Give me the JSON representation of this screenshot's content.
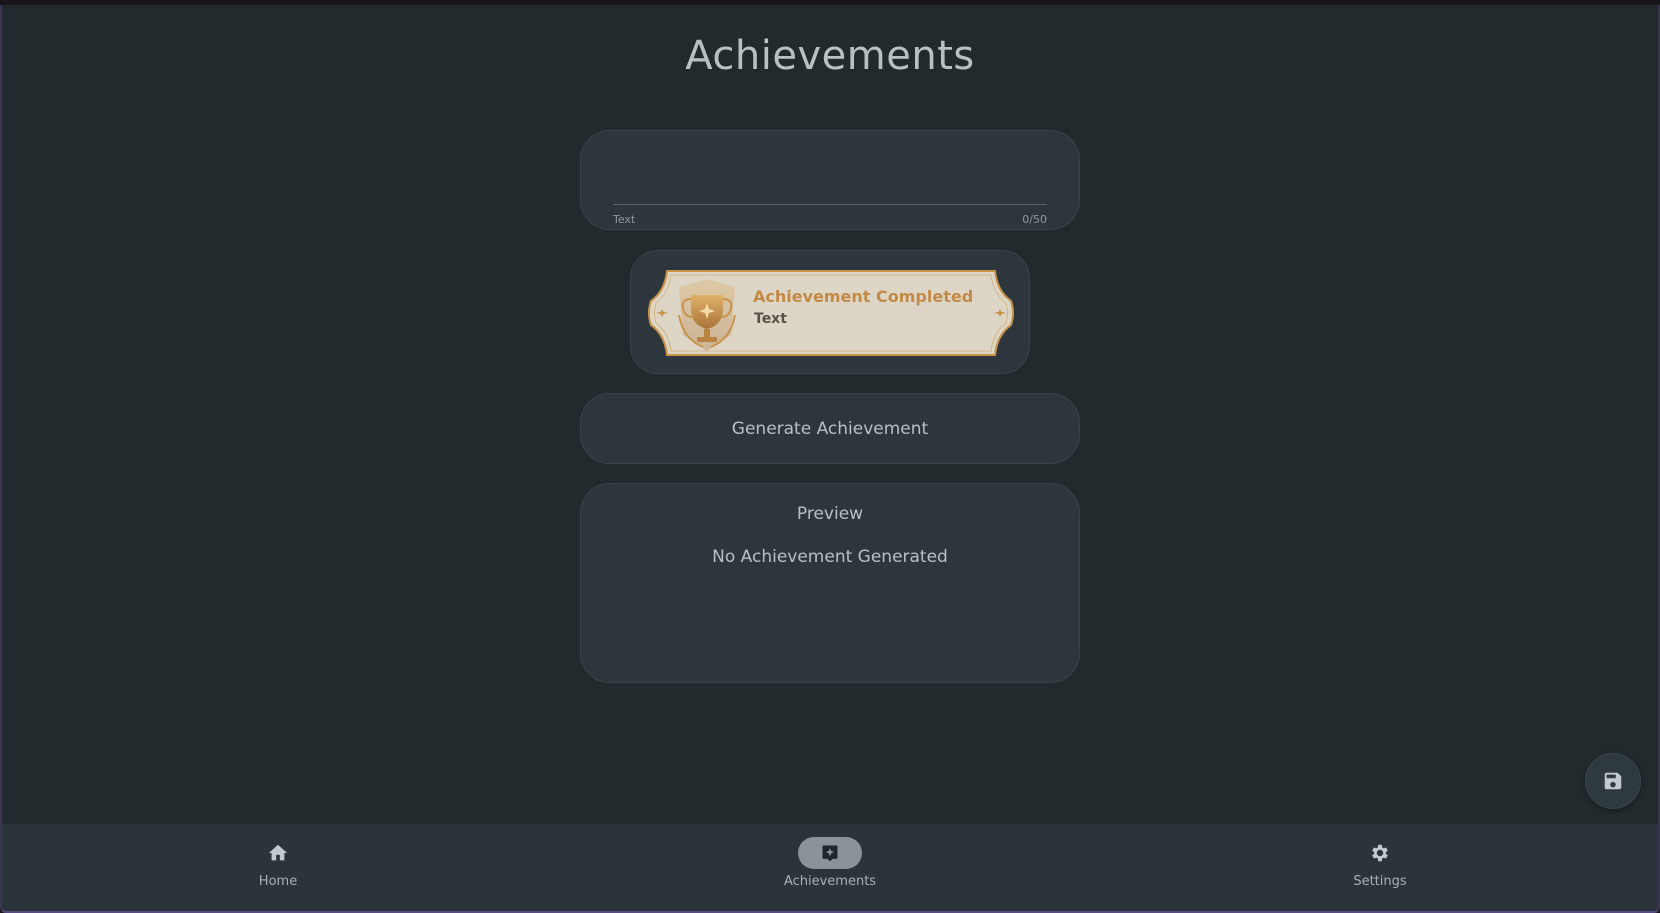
{
  "page": {
    "title": "Achievements"
  },
  "text_field": {
    "label": "Text",
    "counter": "0/50",
    "value": ""
  },
  "banner": {
    "heading": "Achievement Completed",
    "subtext": "Text"
  },
  "generate": {
    "label": "Generate Achievement"
  },
  "preview": {
    "title": "Preview",
    "empty_message": "No Achievement Generated"
  },
  "fab": {
    "icon": "save-icon"
  },
  "nav": {
    "items": [
      {
        "label": "Home",
        "icon": "home-icon",
        "active": false
      },
      {
        "label": "Achievements",
        "icon": "achievement-icon",
        "active": true
      },
      {
        "label": "Settings",
        "icon": "gear-icon",
        "active": false
      }
    ]
  },
  "colors": {
    "background": "#222a2e",
    "card": "#2c363c",
    "nav": "#2b343a",
    "banner_gold": "#c9944a",
    "banner_bg": "#ddd6c7"
  }
}
